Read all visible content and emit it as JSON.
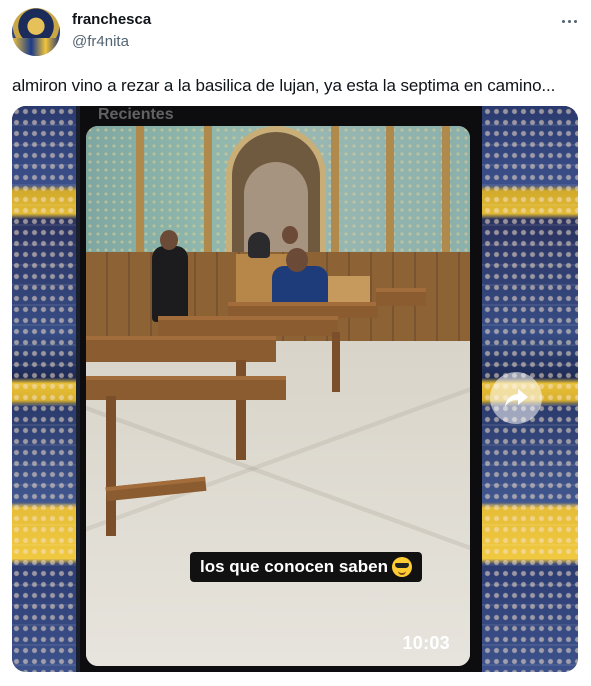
{
  "tweet": {
    "author_name": "franchesca",
    "author_handle": "@fr4nita",
    "text": "almiron vino a rezar a la basilica de lujan, ya esta la septima en camino...",
    "more_icon": "ellipsis-icon"
  },
  "media": {
    "type": "video-screenshot",
    "top_tag": "Recientes",
    "caption": "los que conocen saben",
    "caption_emoji": "sunglasses-face-emoji",
    "timestamp": "10:03",
    "share_icon": "share-arrow-icon"
  },
  "colors": {
    "text_primary": "#0f1419",
    "text_secondary": "#536471",
    "crowd_blue": "#2a3a6e",
    "crowd_gold": "#e2bb35"
  }
}
